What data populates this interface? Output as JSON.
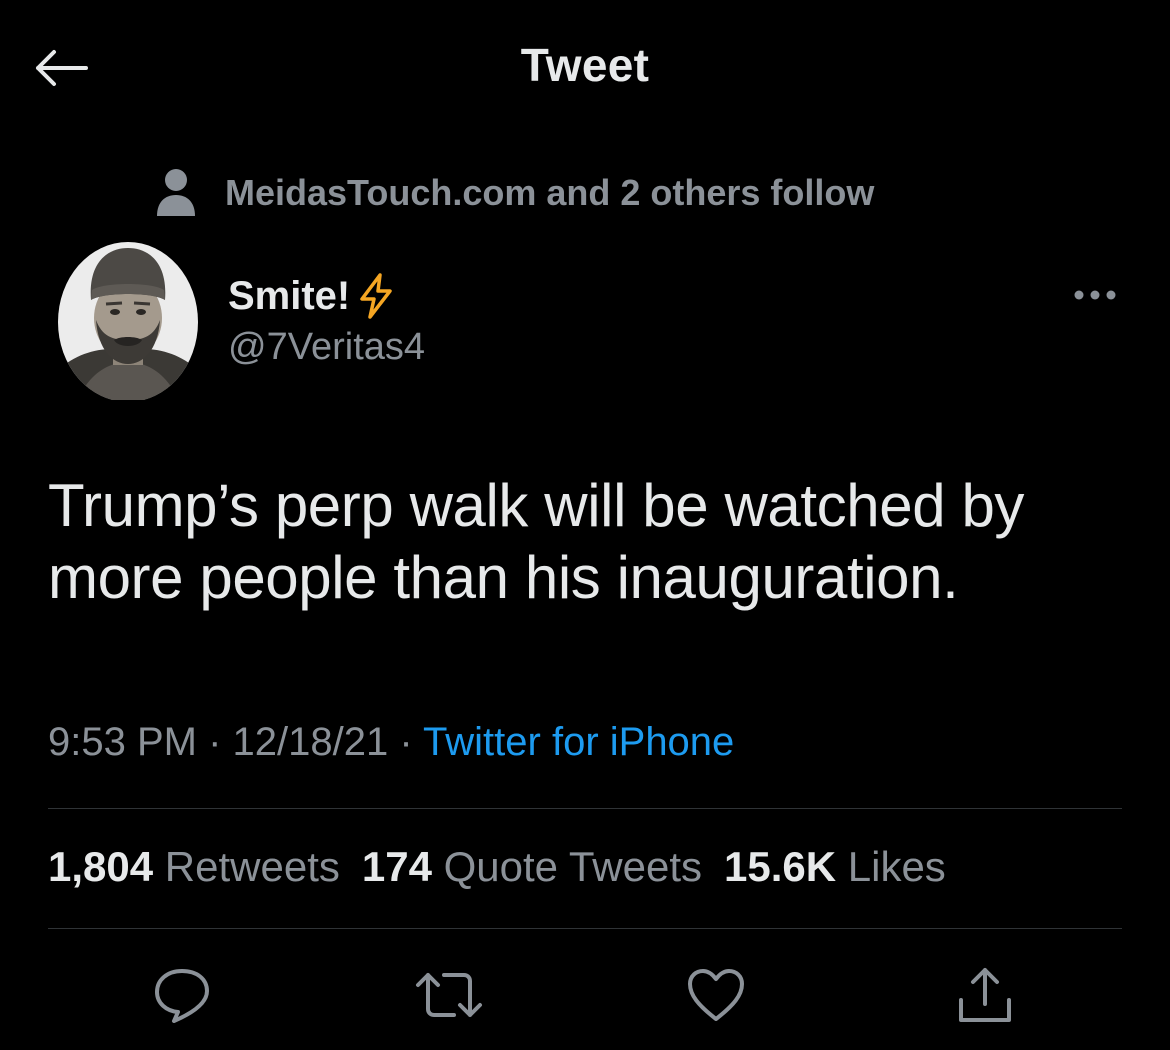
{
  "header": {
    "title": "Tweet",
    "back_icon": "arrow-left-icon"
  },
  "social_context": {
    "icon": "person-icon",
    "text": "MeidasTouch.com and 2 others follow"
  },
  "author": {
    "display_name": "Smite!",
    "emoji_icon": "lightning-bolt-icon",
    "handle": "@7Veritas4"
  },
  "tweet": {
    "text": "Trump’s perp walk will be watched by more people than his inauguration."
  },
  "meta": {
    "time": "9:53 PM",
    "separator": " · ",
    "date": "12/18/21",
    "source": "Twitter for iPhone"
  },
  "stats": {
    "retweets": {
      "count": "1,804",
      "label": "Retweets"
    },
    "quotes": {
      "count": "174",
      "label": "Quote Tweets"
    },
    "likes": {
      "count": "15.6K",
      "label": "Likes"
    }
  },
  "actions": {
    "reply": "reply-icon",
    "retweet": "retweet-icon",
    "like": "heart-icon",
    "share": "share-icon"
  },
  "colors": {
    "background": "#000000",
    "text": "#e7e9ea",
    "secondary": "#8b9198",
    "link": "#1d9bf0",
    "divider": "#2f3336",
    "bolt": "#f5a623"
  }
}
